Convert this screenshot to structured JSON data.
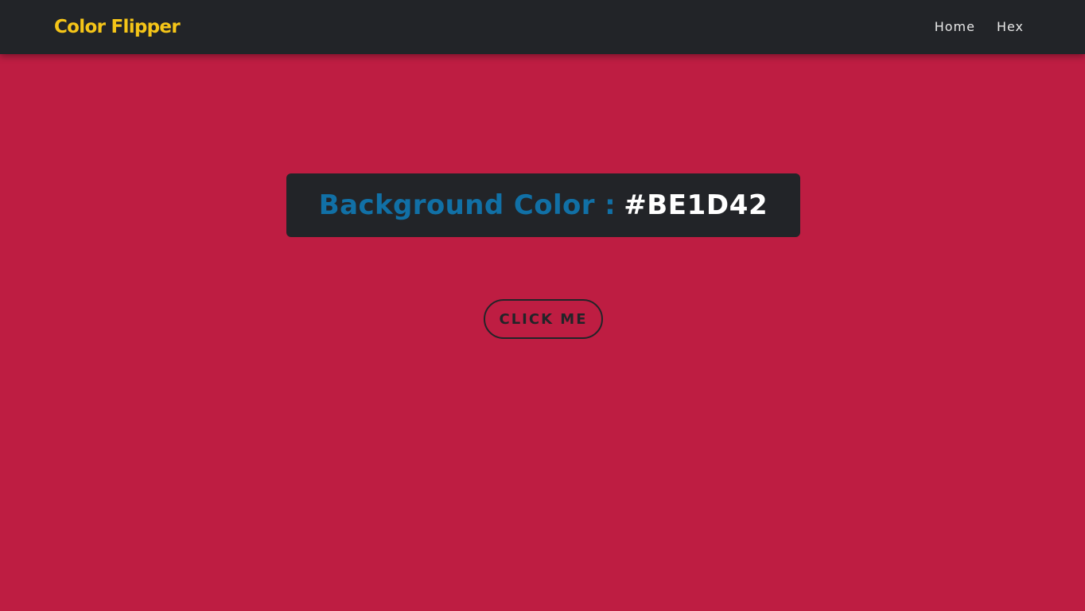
{
  "navbar": {
    "brand": "Color Flipper",
    "links": [
      {
        "label": "Home"
      },
      {
        "label": "Hex"
      }
    ]
  },
  "main": {
    "color_label": "Background Color :",
    "color_value": "#BE1D42",
    "button_label": "CLICK ME"
  },
  "colors": {
    "background": "#BE1D42",
    "navbar": "#222428",
    "brand": "#F5C518",
    "label": "#1170A6",
    "value": "#FFFFFF"
  }
}
